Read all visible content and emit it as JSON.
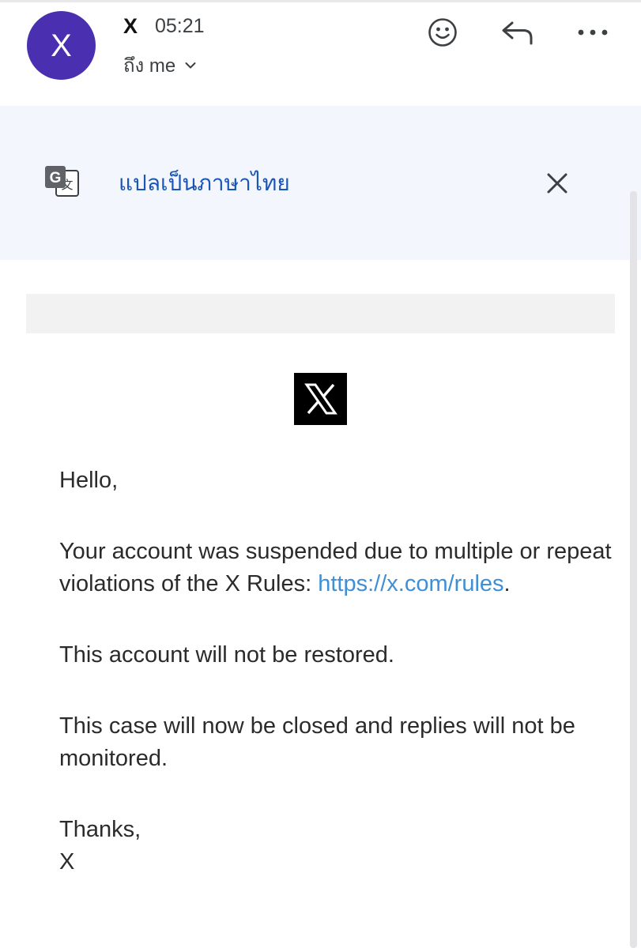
{
  "header": {
    "avatar_letter": "X",
    "sender": "X",
    "time": "05:21",
    "recipient": "ถึง me"
  },
  "icons": {
    "avatar": "avatar",
    "recipient_expand": "chevron-down-icon",
    "emoji": "emoji-smile-icon",
    "reply": "reply-icon",
    "more": "more-horizontal-icon",
    "translate": "translate-icon",
    "close": "close-icon",
    "brand_logo": "x-logo"
  },
  "translate": {
    "label": "แปลเป็นภาษาไทย"
  },
  "email": {
    "greeting": "Hello,",
    "suspension_text": "Your account was suspended due to multiple or repeat violations of the X Rules: ",
    "rules_link": "https://x.com/rules",
    "rules_link_suffix": ".",
    "restored_text": "This account will not be restored.",
    "closed_text": "This case will now be closed and replies will not be monitored.",
    "signoff": "Thanks,",
    "signature": "X"
  },
  "colors": {
    "avatar": "#4a2fb0",
    "translate_banner": "#f3f6fc",
    "translate_link": "#1a56b6",
    "link": "#3e8fd6",
    "logo_background": "#000000"
  }
}
